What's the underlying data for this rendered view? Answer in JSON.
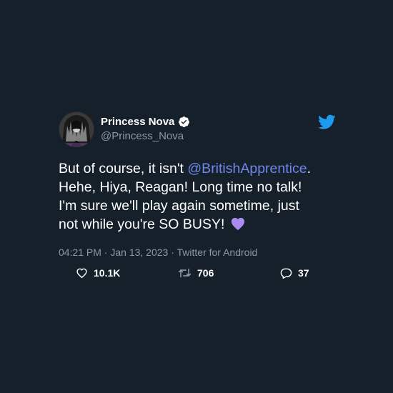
{
  "tweet": {
    "display_name": "Princess Nova",
    "handle": "@Princess_Nova",
    "text_segments": {
      "line1_before": "But of course, it isn't ",
      "mention": "@BritishApprentice",
      "line1_after": ".",
      "line2": "Hehe, Hiya, Reagan! Long time no talk!",
      "line3": "I'm sure we'll play again sometime, just",
      "line4": "not while you're SO BUSY!"
    },
    "emoji": "purple-heart",
    "meta": "04:21 PM · Jan 13, 2023 · Twitter for Android",
    "likes": "10.1K",
    "retweets": "706",
    "replies": "37"
  },
  "colors": {
    "background": "#15202b",
    "mention": "#6f88e8",
    "secondary_text": "#8b98a5",
    "twitter_blue": "#1d9bf0",
    "heart_purple": "#a98ced"
  },
  "icons": {
    "avatar": "avatar",
    "verified": "verified-badge-icon",
    "twitter_logo": "twitter-bird-icon",
    "like": "heart-outline-icon",
    "retweet": "retweet-icon",
    "reply": "reply-bubble-icon"
  }
}
